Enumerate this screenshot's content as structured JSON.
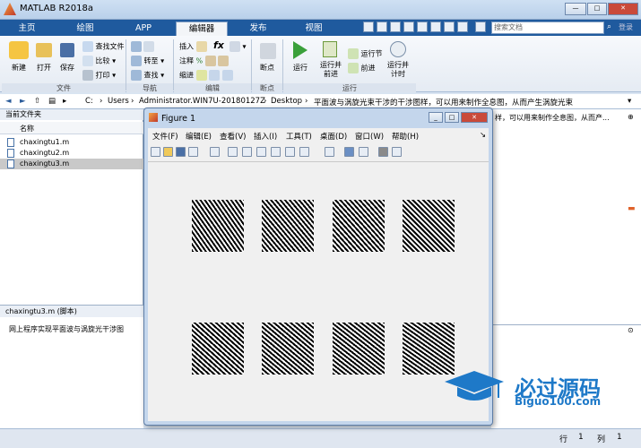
{
  "app": {
    "title": "MATLAB R2018a"
  },
  "tabs": [
    "主页",
    "绘图",
    "APP",
    "编辑器",
    "发布",
    "视图"
  ],
  "search": {
    "placeholder": "搜索文档",
    "login": "登录"
  },
  "ribbon": {
    "file_group": {
      "label": "文件",
      "new": "新建",
      "open": "打开",
      "save": "保存",
      "find_files": "查找文件",
      "compare": "比较",
      "print": "打印"
    },
    "nav_group": {
      "label": "导航",
      "goto": "转至",
      "find": "查找"
    },
    "edit_group": {
      "label": "编辑",
      "insert": "插入",
      "comment": "注释",
      "indent": "缩进",
      "fx": "fx"
    },
    "breakpoint_group": {
      "label": "断点",
      "breakpoints": "断点"
    },
    "run_group": {
      "label": "运行",
      "run": "运行",
      "run_advance": "运行并\n前进",
      "run_section": "运行节",
      "advance": "前进",
      "run_time": "运行并\n计时"
    }
  },
  "address": {
    "parts": [
      "C:",
      "Users",
      "Administrator.WIN7U-20180127Z",
      "Desktop",
      "平面波与涡旋光束干涉的干涉图样，可以用来制作全息图，从而产生涡旋光束"
    ]
  },
  "file_panel": {
    "header": "当前文件夹",
    "column": "名称",
    "files": [
      {
        "name": "chaxingtu1.m",
        "selected": false
      },
      {
        "name": "chaxingtu2.m",
        "selected": false
      },
      {
        "name": "chaxingtu3.m",
        "selected": true
      }
    ]
  },
  "details": {
    "header": "chaxingtu3.m  (脚本)",
    "text": "网上程序实现平面波与涡旋光干涉图"
  },
  "editor_tab_text": "样，可以用来制作全息图，从而产...",
  "figure": {
    "title": "Figure 1",
    "menu": [
      "文件(F)",
      "编辑(E)",
      "查看(V)",
      "插入(I)",
      "工具(T)",
      "桌面(D)",
      "窗口(W)",
      "帮助(H)"
    ]
  },
  "status": {
    "row_label": "行",
    "row": "1",
    "col_label": "列",
    "col": "1"
  },
  "watermark": {
    "text": "必过源码",
    "url": "Biguo100.com"
  },
  "colors": {
    "tab_bar": "#1f5a9e",
    "watermark": "#1e79c8"
  }
}
